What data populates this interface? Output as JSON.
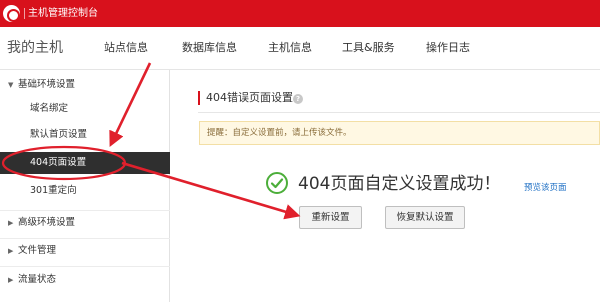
{
  "app": {
    "title": "主机管理控制台"
  },
  "nav": {
    "brand": "我的主机",
    "items": [
      {
        "label": "站点信息"
      },
      {
        "label": "数据库信息"
      },
      {
        "label": "主机信息"
      },
      {
        "label": "工具&服务"
      },
      {
        "label": "操作日志"
      }
    ]
  },
  "sidebar": {
    "groups": [
      {
        "label": "基础环境设置",
        "expanded": true,
        "children": [
          "域名绑定",
          "默认首页设置",
          "404页面设置",
          "301重定向"
        ],
        "active": "404页面设置"
      },
      {
        "label": "高级环境设置",
        "expanded": false
      },
      {
        "label": "文件管理",
        "expanded": false
      },
      {
        "label": "流量状态",
        "expanded": false
      }
    ]
  },
  "main": {
    "section_title": "404错误页面设置",
    "help_glyph": "?",
    "notice": "提醒：自定义设置前，请上传该文件。",
    "success_message": "404页面自定义设置成功！",
    "preview_link": "预览该页面",
    "buttons": {
      "reset": "重新设置",
      "restore": "恢复默认设置"
    }
  },
  "colors": {
    "brand_red": "#d8111c",
    "active_bg": "#2f2f2f",
    "success_green": "#4cae3a",
    "link_blue": "#1e6fc4",
    "notice_bg": "#fff8e3"
  },
  "icons": {
    "logo": "brand-logo-icon",
    "help": "question-circle-icon",
    "success": "check-circle-icon",
    "caret_open": "caret-down-icon",
    "caret_closed": "caret-right-icon"
  }
}
